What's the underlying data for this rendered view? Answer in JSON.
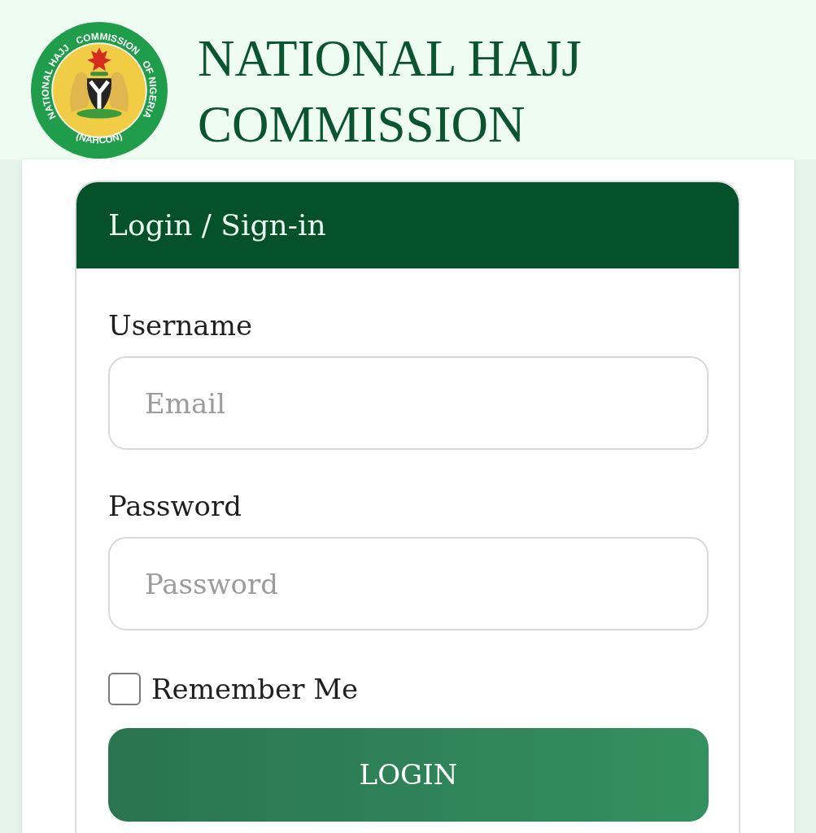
{
  "header": {
    "logo": {
      "ring_text": [
        "NATIONAL HAJJ",
        "COMMISSION",
        "OF NIGERIA"
      ],
      "acronym": "(NAHCON)"
    },
    "title": "NATIONAL HAJJ COMMISSION"
  },
  "login_card": {
    "title": "Login / Sign-in",
    "fields": [
      {
        "label": "Username",
        "placeholder": "Email"
      },
      {
        "label": "Password",
        "placeholder": "Password"
      }
    ],
    "remember_me": {
      "label": "Remember Me",
      "checked": false
    },
    "login_button": "LOGIN"
  }
}
